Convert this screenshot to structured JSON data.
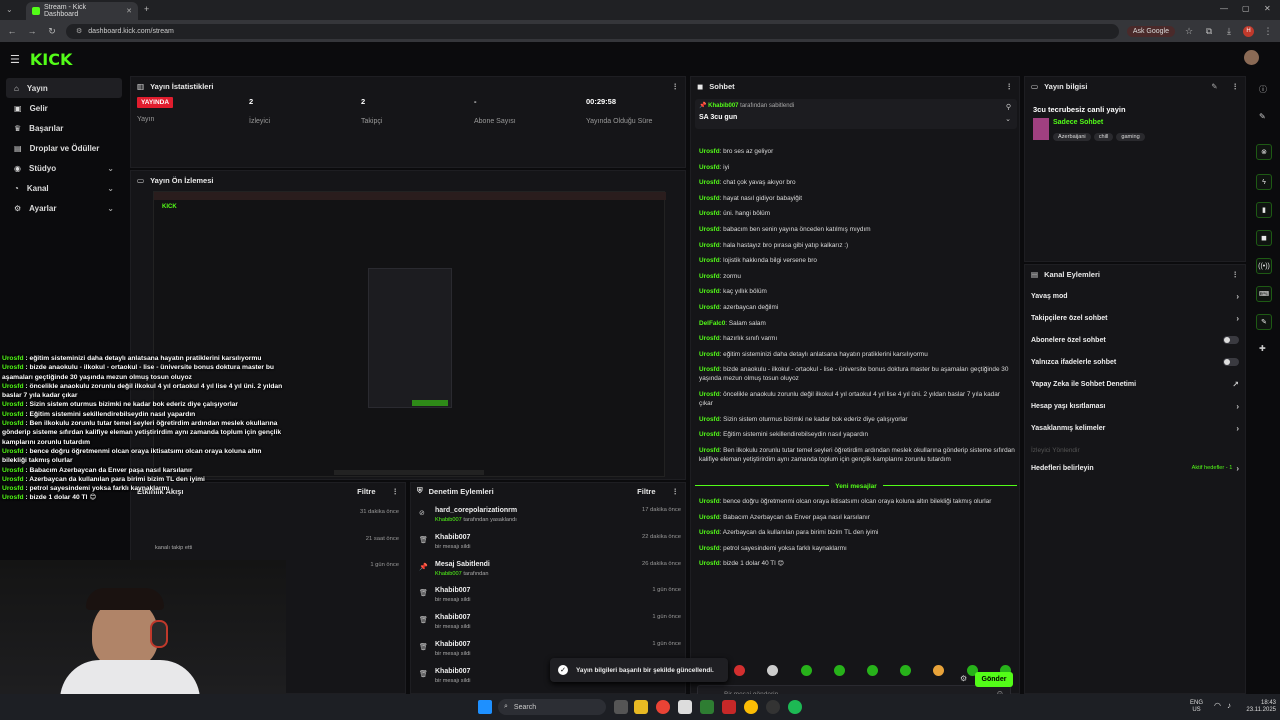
{
  "browser": {
    "tab_title": "Stream - Kick Dashboard",
    "url": "dashboard.kick.com/stream",
    "ask_google": "Ask Google",
    "profile_initial": "H"
  },
  "app": {
    "logo": "KICK",
    "sidebar": [
      {
        "label": "Yayın",
        "icon": "home-icon",
        "active": true
      },
      {
        "label": "Gelir",
        "icon": "money-icon"
      },
      {
        "label": "Başarılar",
        "icon": "trophy-icon"
      },
      {
        "label": "Droplar ve Ödüller",
        "icon": "gift-icon"
      },
      {
        "label": "Stüdyo",
        "icon": "studio-icon",
        "chevron": true
      },
      {
        "label": "Kanal",
        "icon": "user-icon",
        "chevron": true
      },
      {
        "label": "Ayarlar",
        "icon": "gear-icon",
        "chevron": true
      }
    ]
  },
  "stats": {
    "title": "Yayın İstatistikleri",
    "live_badge": "YAYINDA",
    "live_label": "Yayın",
    "viewers": {
      "value": "2",
      "label": "İzleyici"
    },
    "followers": {
      "value": "2",
      "label": "Takipçi"
    },
    "subs": {
      "value": "-",
      "label": "Abone Sayısı"
    },
    "uptime": {
      "value": "00:29:58",
      "label": "Yayında Olduğu Süre"
    }
  },
  "preview": {
    "title": "Yayın Ön İzlemesi"
  },
  "activity": {
    "title": "Etkinlik Akışı",
    "filter": "Filtre",
    "items": [
      {
        "time": "31 dakika önce"
      },
      {
        "time": "21 saat önce",
        "desc": "kanalı takip etti"
      },
      {
        "time": "1 gün önce"
      }
    ]
  },
  "moderation": {
    "title": "Denetim Eylemleri",
    "filter": "Filtre",
    "items": [
      {
        "icon": "ban-icon",
        "name": "hard_corepolarizationrm",
        "by": "Khabib007",
        "desc": "tarafından yasaklandı",
        "time": "17 dakika önce"
      },
      {
        "icon": "trash-icon",
        "name": "Khabib007",
        "desc": "bir mesajı sildi",
        "time": "22 dakika önce"
      },
      {
        "icon": "pin-icon",
        "name": "Mesaj Sabitlendi",
        "by": "Khabib007",
        "desc": "tarafından",
        "time": "26 dakika önce"
      },
      {
        "icon": "trash-icon",
        "name": "Khabib007",
        "desc": "bir mesajı sildi",
        "time": "1 gün önce"
      },
      {
        "icon": "trash-icon",
        "name": "Khabib007",
        "desc": "bir mesajı sildi",
        "time": "1 gün önce"
      },
      {
        "icon": "trash-icon",
        "name": "Khabib007",
        "desc": "bir mesajı sildi",
        "time": "1 gün önce"
      },
      {
        "icon": "trash-icon",
        "name": "Khabib007",
        "desc": "bir mesajı sildi",
        "time": ""
      }
    ]
  },
  "chat": {
    "title": "Sohbet",
    "pinned_by": "Khabib007",
    "pinned_by_suffix": "tarafından sabitlendi",
    "pinned_msg": "SA 3cu gun",
    "messages": [
      {
        "user": "Urosfd",
        "text": "bro ses az geliyor"
      },
      {
        "user": "Urosfd",
        "text": "iyi"
      },
      {
        "user": "Urosfd",
        "text": "chat çok yavaş akıyor bro"
      },
      {
        "user": "Urosfd",
        "text": "hayat nasıl gidiyor babayiğit"
      },
      {
        "user": "Urosfd",
        "text": "üni. hangi bölüm"
      },
      {
        "user": "Urosfd",
        "text": "babacım ben senin yayına önceden katılmış mıydım"
      },
      {
        "user": "Urosfd",
        "text": "hala hastayız bro pırasa gibi yatıp kalkarız :)"
      },
      {
        "user": "Urosfd",
        "text": "lojistik hakkında bilgi versene bro"
      },
      {
        "user": "Urosfd",
        "text": "zormu"
      },
      {
        "user": "Urosfd",
        "text": "kaç yıllık bölüm"
      },
      {
        "user": "Urosfd",
        "text": "azerbaycan değilmi"
      },
      {
        "user": "DelFalc0",
        "text": "Salam salam"
      },
      {
        "user": "Urosfd",
        "text": "hazırlık sınıfı varmı"
      },
      {
        "user": "Urosfd",
        "text": "eğitim sisteminizi daha detaylı anlatsana hayatın pratiklerini karsılıyormu"
      },
      {
        "user": "Urosfd",
        "text": "bizde anaokulu - ilkokul - ortaokul - lise - üniversite bonus doktura master bu aşamaları geçtiğinde 30 yaşında mezun olmuş tosun oluyoz"
      },
      {
        "user": "Urosfd",
        "text": "öncelikle anaokulu zorunlu değil ilkokul 4 yıl ortaokul 4 yıl lise 4 yıl üni. 2 yıldan baslar 7 yıla kadar çıkar"
      },
      {
        "user": "Urosfd",
        "text": "Sizin sistem oturmus bizimki ne kadar bok ederiz diye çalışıyorlar"
      },
      {
        "user": "Urosfd",
        "text": "Eğitim sistemini sekillendirebilseydin nasıl yapardın"
      },
      {
        "user": "Urosfd",
        "text": "Ben ilkokulu zorunlu tutar temel seyleri öğretirdim ardından meslek okullarına gönderip sisteme sıfırdan kalifiye eleman yetiştirirdim aynı zamanda toplum için gençlik kamplarını zorunlu tutardım"
      }
    ],
    "new_label": "Yeni mesajlar",
    "new_messages": [
      {
        "user": "Urosfd",
        "text": "bence doğru öğretmenmi olcan oraya iktisatsımı olcan oraya koluna altın bilekliği takmış olurlar"
      },
      {
        "user": "Urosfd",
        "text": "Babacım Azerbaycan da Enver paşa nasıl karsılanır"
      },
      {
        "user": "Urosfd",
        "text": "Azerbaycan da kullanılan para birimi bizim TL den iyimi"
      },
      {
        "user": "Urosfd",
        "text": "petrol sayesindemi yoksa farklı kaynaklarmı"
      },
      {
        "user": "Urosfd",
        "text": "bizde 1 dolar 40 Tl 😊"
      }
    ],
    "input_placeholder": "Bir mesaj gönderin",
    "send": "Gönder"
  },
  "stream_info": {
    "title": "Yayın bilgisi",
    "stream_title": "3cu tecrubesiz canli yayin",
    "category": "Sadece Sohbet",
    "tags": [
      "Azerbaijani",
      "chill",
      "gaming"
    ]
  },
  "channel_actions": {
    "title": "Kanal Eylemleri",
    "items": [
      {
        "label": "Yavaş mod",
        "type": "arrow"
      },
      {
        "label": "Takipçilere özel sohbet",
        "type": "arrow"
      },
      {
        "label": "Abonelere özel sohbet",
        "type": "toggle"
      },
      {
        "label": "Yalnızca ifadelerle sohbet",
        "type": "toggle"
      },
      {
        "label": "Yapay Zeka ile Sohbet Denetimi",
        "type": "ext"
      },
      {
        "label": "Hesap yaşı kısıtlaması",
        "type": "arrow"
      },
      {
        "label": "Yasaklanmış kelimeler",
        "type": "arrow"
      }
    ],
    "dim_label": "İzleyici Yönlendir",
    "goals_label": "Hedefleri belirleyin",
    "goals_status": "Aktif hedefler - 1"
  },
  "overlay_chat": [
    {
      "user": "Urosfd",
      "text": ": eğitim sisteminizi daha detaylı anlatsana hayatın pratiklerini karsılıyormu"
    },
    {
      "user": "Urosfd",
      "text": ": bizde anaokulu - ilkokul - ortaokul - lise - üniversite bonus doktura master bu aşamaları geçtiğinde 30 yaşında mezun olmuş tosun oluyoz"
    },
    {
      "user": "Urosfd",
      "text": ": öncelikle anaokulu zorunlu değil ilkokul 4 yıl ortaokul 4 yıl lise 4 yıl üni. 2 yıldan baslar 7 yıla kadar çıkar"
    },
    {
      "user": "Urosfd",
      "text": ": Sizin sistem oturmus bizimki ne kadar bok ederiz diye çalışıyorlar"
    },
    {
      "user": "Urosfd",
      "text": ": Eğitim sistemini sekillendirebilseydin nasıl yapardın"
    },
    {
      "user": "Urosfd",
      "text": ": Ben ilkokulu zorunlu tutar temel seyleri öğretirdim ardından meslek okullarına gönderip sisteme sıfırdan kalifiye eleman yetiştirirdim aynı zamanda toplum için gençlik kamplarını zorunlu tutardım"
    },
    {
      "user": "Urosfd",
      "text": ": bence doğru öğretmenmi olcan oraya iktisatsımı olcan oraya koluna altın bilekliği takmış olurlar"
    },
    {
      "user": "Urosfd",
      "text": ": Babacım Azerbaycan da Enver paşa nasıl karsılanır"
    },
    {
      "user": "Urosfd",
      "text": ": Azerbaycan da kullanılan para birimi bizim TL den iyimi"
    },
    {
      "user": "Urosfd",
      "text": ": petrol sayesindemi yoksa farklı kaynaklarmı"
    },
    {
      "user": "Urosfd",
      "text": ": bizde 1 dolar 40 Tl 😊"
    }
  ],
  "toast": "Yayın bilgileri başarılı bir şekilde güncellendi.",
  "taskbar": {
    "search": "Search",
    "lang": "ENG",
    "region": "US",
    "time": "18:43",
    "date": "23.11.2025"
  },
  "colors": {
    "accent": "#53fc18",
    "live": "#e11d2e",
    "panel": "#151518",
    "bg": "#0b0b0d"
  }
}
